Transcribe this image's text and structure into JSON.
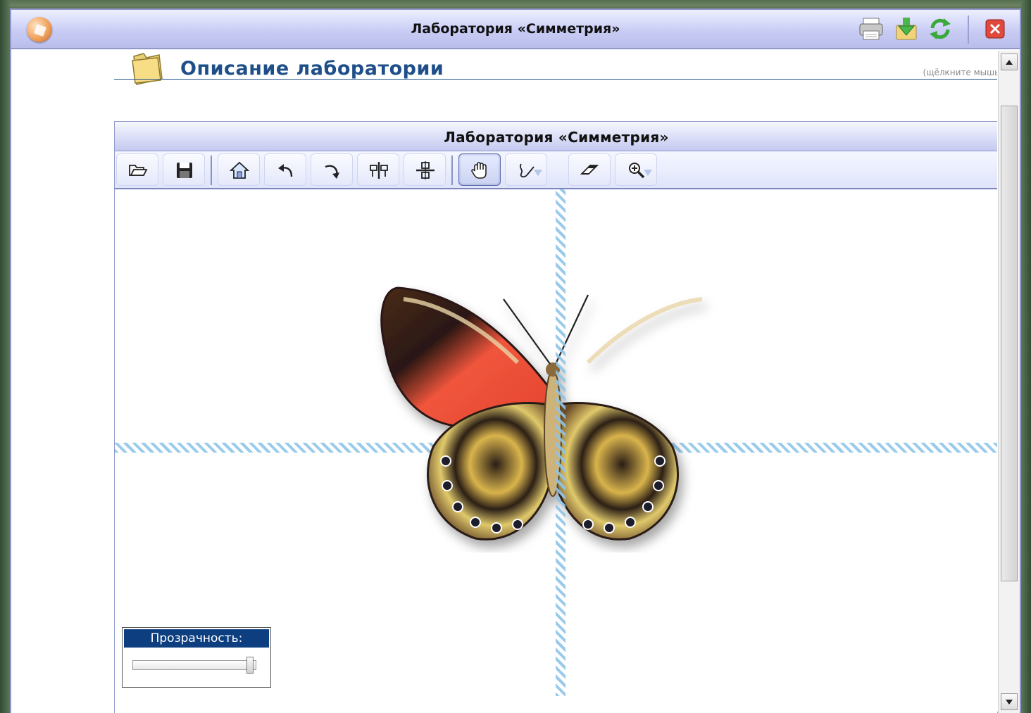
{
  "window": {
    "title": "Лаборатория «Симметрия»",
    "actions": [
      "print-icon",
      "download-icon",
      "refresh-icon",
      "close-icon"
    ]
  },
  "section": {
    "title": "Описание лаборатории",
    "hint": "(щёлкните мышью)"
  },
  "lab": {
    "title": "Лаборатория «Симметрия»",
    "tools": [
      "open-icon",
      "save-icon",
      "home-icon",
      "undo-icon",
      "redo-icon",
      "vertical-symmetry-icon",
      "horizontal-symmetry-icon",
      "hand-icon",
      "pen-icon",
      "eraser-icon",
      "zoom-icon"
    ],
    "active_tool": "hand-icon"
  },
  "transparency": {
    "label": "Прозрачность:",
    "value": 0.97
  },
  "colors": {
    "title_blue": "#1f4f88",
    "label_bg": "#0d3f80",
    "axis": "#8ec5e8"
  }
}
